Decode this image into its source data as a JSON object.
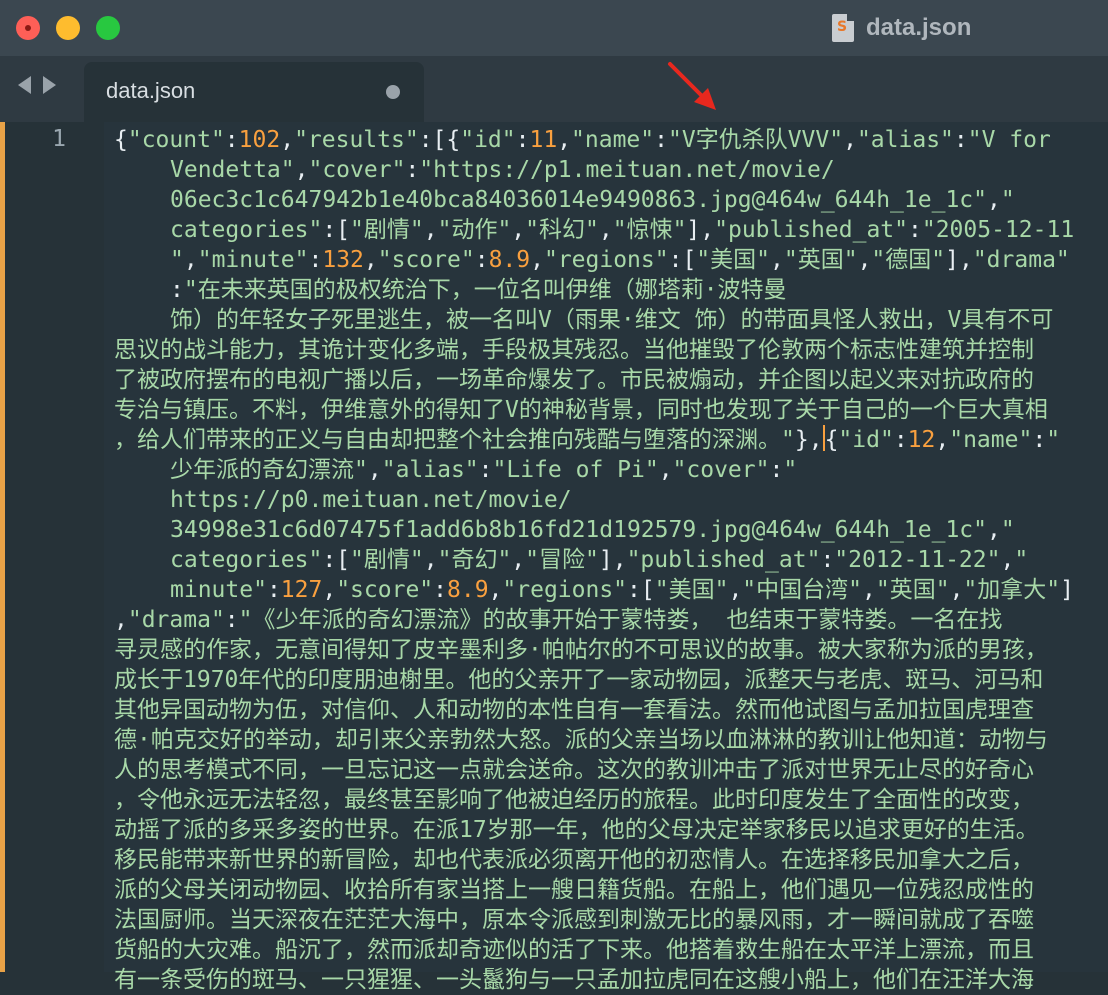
{
  "window": {
    "title": "data.json",
    "file_icon": "sublime-file-icon"
  },
  "tabs": [
    {
      "label": "data.json",
      "modified": true
    }
  ],
  "editor": {
    "line_number": "1",
    "lines": [
      [
        [
          "p",
          "{"
        ],
        [
          "k",
          "\"count\""
        ],
        [
          "p",
          ":"
        ],
        [
          "n",
          "102"
        ],
        [
          "p",
          ","
        ],
        [
          "k",
          "\"results\""
        ],
        [
          "p",
          ":[{"
        ],
        [
          "k",
          "\"id\""
        ],
        [
          "p",
          ":"
        ],
        [
          "n",
          "11"
        ],
        [
          "p",
          ","
        ],
        [
          "k",
          "\"name\""
        ],
        [
          "p",
          ":"
        ],
        [
          "k",
          "\"V字仇杀队VVV\""
        ],
        [
          "p",
          ","
        ],
        [
          "k",
          "\"alias\""
        ],
        [
          "p",
          ":"
        ],
        [
          "k",
          "\"V for"
        ]
      ],
      [
        [
          "k",
          "Vendetta\""
        ],
        [
          "p",
          ","
        ],
        [
          "k",
          "\"cover\""
        ],
        [
          "p",
          ":"
        ],
        [
          "k",
          "\"https://p1.meituan.net/movie/"
        ]
      ],
      [
        [
          "k",
          "06ec3c1c647942b1e40bca84036014e9490863.jpg@464w_644h_1e_1c\""
        ],
        [
          "p",
          ","
        ],
        [
          "k",
          "\""
        ]
      ],
      [
        [
          "k",
          "categories\""
        ],
        [
          "p",
          ":["
        ],
        [
          "k",
          "\"剧情\""
        ],
        [
          "p",
          ","
        ],
        [
          "k",
          "\"动作\""
        ],
        [
          "p",
          ","
        ],
        [
          "k",
          "\"科幻\""
        ],
        [
          "p",
          ","
        ],
        [
          "k",
          "\"惊悚\""
        ],
        [
          "p",
          "],"
        ],
        [
          "k",
          "\"published_at\""
        ],
        [
          "p",
          ":"
        ],
        [
          "k",
          "\"2005-12-11"
        ]
      ],
      [
        [
          "k",
          "\""
        ],
        [
          "p",
          ","
        ],
        [
          "k",
          "\"minute\""
        ],
        [
          "p",
          ":"
        ],
        [
          "n",
          "132"
        ],
        [
          "p",
          ","
        ],
        [
          "k",
          "\"score\""
        ],
        [
          "p",
          ":"
        ],
        [
          "n",
          "8.9"
        ],
        [
          "p",
          ","
        ],
        [
          "k",
          "\"regions\""
        ],
        [
          "p",
          ":["
        ],
        [
          "k",
          "\"美国\""
        ],
        [
          "p",
          ","
        ],
        [
          "k",
          "\"英国\""
        ],
        [
          "p",
          ","
        ],
        [
          "k",
          "\"德国\""
        ],
        [
          "p",
          "],"
        ],
        [
          "k",
          "\"drama\""
        ]
      ],
      [
        [
          "p",
          ":"
        ],
        [
          "k",
          "\"在未来英国的极权统治下，一位名叫伊维（娜塔莉·波特曼"
        ]
      ],
      [
        [
          "k",
          "饰）的年轻女子死里逃生，被一名叫V（雨果·维文 饰）的带面具怪人救出，V具有不可"
        ]
      ],
      [
        [
          "k",
          "思议的战斗能力，其诡计变化多端，手段极其残忍。当他摧毁了伦敦两个标志性建筑并控制"
        ]
      ],
      [
        [
          "k",
          "了被政府摆布的电视广播以后，一场革命爆发了。市民被煽动，并企图以起义来对抗政府的"
        ]
      ],
      [
        [
          "k",
          "专治与镇压。不料，伊维意外的得知了V的神秘背景，同时也发现了关于自己的一个巨大真相"
        ]
      ],
      [
        [
          "k",
          "，给人们带来的正义与自由却把整个社会推向残酷与堕落的深渊。\""
        ],
        [
          "p",
          "},"
        ],
        [
          "c",
          ""
        ],
        [
          "p",
          "{"
        ],
        [
          "k",
          "\"id\""
        ],
        [
          "p",
          ":"
        ],
        [
          "n",
          "12"
        ],
        [
          "p",
          ","
        ],
        [
          "k",
          "\"name\""
        ],
        [
          "p",
          ":"
        ],
        [
          "k",
          "\""
        ]
      ],
      [
        [
          "k",
          "少年派的奇幻漂流\""
        ],
        [
          "p",
          ","
        ],
        [
          "k",
          "\"alias\""
        ],
        [
          "p",
          ":"
        ],
        [
          "k",
          "\"Life of Pi\""
        ],
        [
          "p",
          ","
        ],
        [
          "k",
          "\"cover\""
        ],
        [
          "p",
          ":"
        ],
        [
          "k",
          "\""
        ]
      ],
      [
        [
          "k",
          "https://p0.meituan.net/movie/"
        ]
      ],
      [
        [
          "k",
          "34998e31c6d07475f1add6b8b16fd21d192579.jpg@464w_644h_1e_1c\""
        ],
        [
          "p",
          ","
        ],
        [
          "k",
          "\""
        ]
      ],
      [
        [
          "k",
          "categories\""
        ],
        [
          "p",
          ":["
        ],
        [
          "k",
          "\"剧情\""
        ],
        [
          "p",
          ","
        ],
        [
          "k",
          "\"奇幻\""
        ],
        [
          "p",
          ","
        ],
        [
          "k",
          "\"冒险\""
        ],
        [
          "p",
          "],"
        ],
        [
          "k",
          "\"published_at\""
        ],
        [
          "p",
          ":"
        ],
        [
          "k",
          "\"2012-11-22\""
        ],
        [
          "p",
          ","
        ],
        [
          "k",
          "\""
        ]
      ],
      [
        [
          "k",
          "minute\""
        ],
        [
          "p",
          ":"
        ],
        [
          "n",
          "127"
        ],
        [
          "p",
          ","
        ],
        [
          "k",
          "\"score\""
        ],
        [
          "p",
          ":"
        ],
        [
          "n",
          "8.9"
        ],
        [
          "p",
          ","
        ],
        [
          "k",
          "\"regions\""
        ],
        [
          "p",
          ":["
        ],
        [
          "k",
          "\"美国\""
        ],
        [
          "p",
          ","
        ],
        [
          "k",
          "\"中国台湾\""
        ],
        [
          "p",
          ","
        ],
        [
          "k",
          "\"英国\""
        ],
        [
          "p",
          ","
        ],
        [
          "k",
          "\"加拿大\""
        ],
        [
          "p",
          "]"
        ]
      ],
      [
        [
          "p",
          ","
        ],
        [
          "k",
          "\"drama\""
        ],
        [
          "p",
          ":"
        ],
        [
          "k",
          "\"《少年派的奇幻漂流》的故事开始于蒙特娄， 也结束于蒙特娄。一名在找"
        ]
      ],
      [
        [
          "k",
          "寻灵感的作家，无意间得知了皮辛墨利多·帕帖尔的不可思议的故事。被大家称为派的男孩，"
        ]
      ],
      [
        [
          "k",
          "成长于1970年代的印度朋迪榭里。他的父亲开了一家动物园，派整天与老虎、斑马、河马和"
        ]
      ],
      [
        [
          "k",
          "其他异国动物为伍，对信仰、人和动物的本性自有一套看法。然而他试图与孟加拉国虎理查"
        ]
      ],
      [
        [
          "k",
          "德·帕克交好的举动，却引来父亲勃然大怒。派的父亲当场以血淋淋的教训让他知道：动物与"
        ]
      ],
      [
        [
          "k",
          "人的思考模式不同，一旦忘记这一点就会送命。这次的教训冲击了派对世界无止尽的好奇心"
        ]
      ],
      [
        [
          "k",
          "，令他永远无法轻忽，最终甚至影响了他被迫经历的旅程。此时印度发生了全面性的改变，"
        ]
      ],
      [
        [
          "k",
          "动摇了派的多采多姿的世界。在派17岁那一年，他的父母决定举家移民以追求更好的生活。"
        ]
      ],
      [
        [
          "k",
          "移民能带来新世界的新冒险，却也代表派必须离开他的初恋情人。在选择移民加拿大之后，"
        ]
      ],
      [
        [
          "k",
          "派的父母关闭动物园、收拾所有家当搭上一艘日籍货船。在船上，他们遇见一位残忍成性的"
        ]
      ],
      [
        [
          "k",
          "法国厨师。当天深夜在茫茫大海中，原本令派感到刺激无比的暴风雨，才一瞬间就成了吞噬"
        ]
      ],
      [
        [
          "k",
          "货船的大灾难。船沉了，然而派却奇迹似的活了下来。他搭着救生船在太平洋上漂流，而且"
        ]
      ],
      [
        [
          "k",
          "有一条受伤的斑马、一只猩猩、一头鬣狗与一只孟加拉虎同在这艘小船上，他们在汪洋大海"
        ]
      ]
    ]
  },
  "colors": {
    "background": "#263238",
    "string": "#a8d8a8",
    "number": "#f9a03f",
    "punctuation": "#e8eef2",
    "annotation_arrow": "#e8281e"
  }
}
